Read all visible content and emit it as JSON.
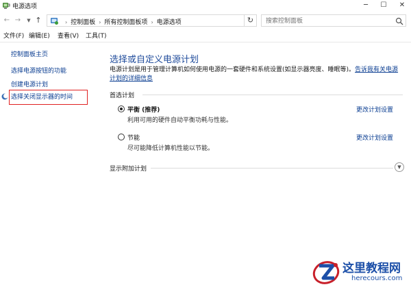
{
  "window": {
    "title": "电源选项",
    "icon": "power-options-icon",
    "controls": [
      "minimize-icon",
      "maximize-icon",
      "close-icon"
    ]
  },
  "address": {
    "crumbs": [
      "控制面板",
      "所有控制面板项",
      "电源选项"
    ],
    "search_placeholder": "搜索控制面板"
  },
  "menu": {
    "file": "文件(F)",
    "edit": "编辑(E)",
    "view": "查看(V)",
    "tools": "工具(T)"
  },
  "sidebar": {
    "home": "控制面板主页",
    "items": [
      "选择电源按钮的功能",
      "创建电源计划",
      "选择关闭显示器的时间"
    ]
  },
  "main": {
    "title": "选择或自定义电源计划",
    "description": "电源计划是用于管理计算机如何使用电源的一套硬件和系统设置(如显示器亮度、睡眠等)。",
    "description_link": "告诉我有关电源计划的详细信息",
    "preferred_label": "首选计划",
    "plans": [
      {
        "name": "平衡 (推荐)",
        "desc": "利用可用的硬件自动平衡功耗与性能。",
        "selected": true,
        "change_link": "更改计划设置"
      },
      {
        "name": "节能",
        "desc": "尽可能降低计算机性能以节能。",
        "selected": false,
        "change_link": "更改计划设置"
      }
    ],
    "additional_label": "显示附加计划"
  },
  "watermark": {
    "title": "这里教程网",
    "url": "herecours.com"
  },
  "colors": {
    "link": "#0a3d91",
    "heading": "#1f4b9b",
    "highlight": "#e02020",
    "watermark": "#1c4fa8"
  }
}
